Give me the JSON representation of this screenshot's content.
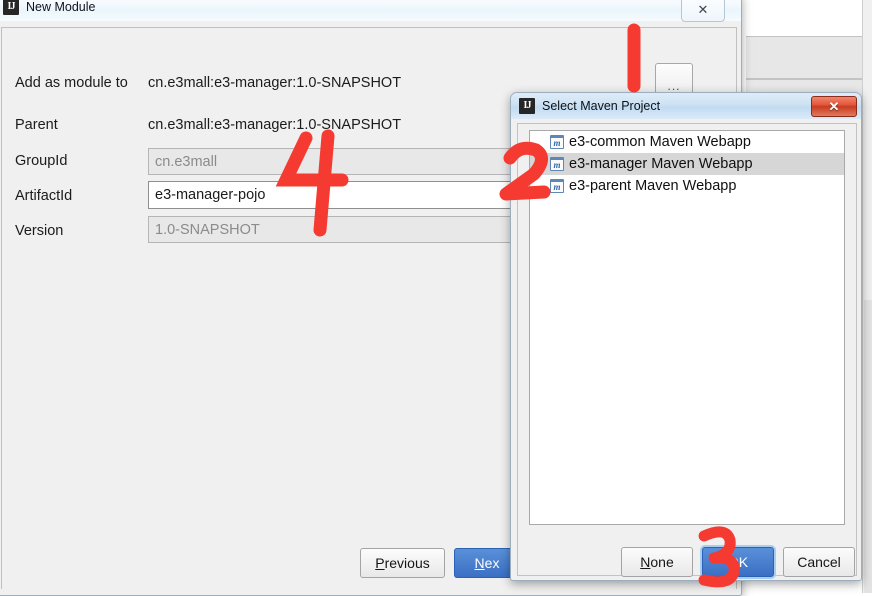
{
  "accent": {
    "annotation_red": "#f53a32",
    "primary_button_blue": "#3a6fc4",
    "selection_gray": "#d6d6d6"
  },
  "new_module_dialog": {
    "title": "New Module",
    "icon": "intellij-idea-icon",
    "close_label": "✕",
    "fields": [
      {
        "label": "Add as module to",
        "value": "cn.e3mall:e3-manager:1.0-SNAPSHOT",
        "type": "static",
        "state": "static"
      },
      {
        "label": "Parent",
        "value": "cn.e3mall:e3-manager:1.0-SNAPSHOT",
        "type": "static",
        "state": "static"
      },
      {
        "label": "GroupId",
        "value": "cn.e3mall",
        "type": "input",
        "state": "disabled"
      },
      {
        "label": "ArtifactId",
        "value": "e3-manager-pojo",
        "type": "input",
        "state": "enabled"
      },
      {
        "label": "Version",
        "value": "1.0-SNAPSHOT",
        "type": "input",
        "state": "disabled"
      }
    ],
    "browse_buttons": [
      {
        "label": "...",
        "name": "browse-add-as-module-to"
      },
      {
        "label": "...",
        "name": "browse-parent"
      }
    ],
    "footer": {
      "previous": {
        "pre": "",
        "mnemonic": "P",
        "post": "revious"
      },
      "next": {
        "pre": "",
        "mnemonic": "N",
        "post": "ex"
      }
    }
  },
  "select_maven_dialog": {
    "title": "Select Maven Project",
    "icon": "intellij-idea-icon",
    "close_label": "✕",
    "projects": [
      {
        "name": "e3-common Maven Webapp",
        "selected": false
      },
      {
        "name": "e3-manager Maven Webapp",
        "selected": true
      },
      {
        "name": "e3-parent Maven Webapp",
        "selected": false
      }
    ],
    "buttons": {
      "none": {
        "pre": "",
        "mnemonic": "N",
        "post": "one"
      },
      "ok": {
        "label": "OK"
      },
      "cancel": {
        "label": "Cancel"
      }
    }
  },
  "annotations": [
    {
      "text": "1",
      "name": "annotation-step-1",
      "target": "browse-add-as-module-to"
    },
    {
      "text": "2",
      "name": "annotation-step-2",
      "target": "maven-project-list"
    },
    {
      "text": "3",
      "name": "annotation-step-3",
      "target": "ok-button"
    },
    {
      "text": "4",
      "name": "annotation-step-4",
      "target": "artifactid-field"
    }
  ]
}
